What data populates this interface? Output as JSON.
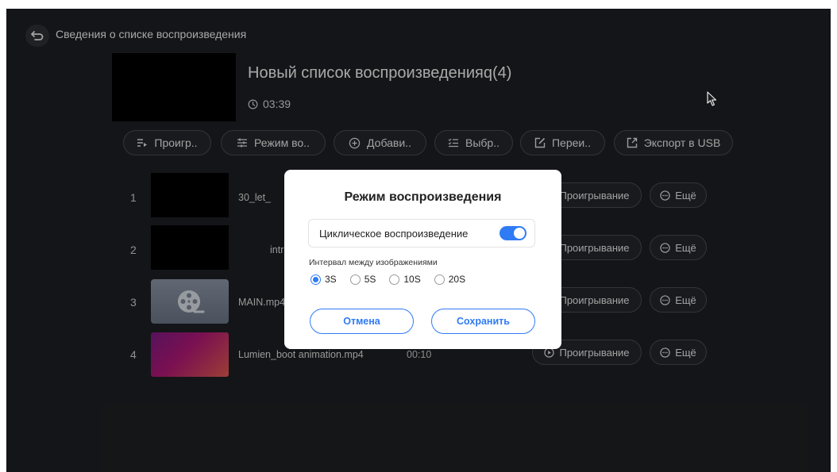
{
  "header": {
    "title": "Сведения о списке воспроизведения"
  },
  "playlist": {
    "title": "Новый список воспроизведенияq(4)",
    "duration": "03:39"
  },
  "toolbar": {
    "play": "Проигр..",
    "mode": "Режим во..",
    "add": "Добави..",
    "select": "Выбр..",
    "rename": "Переи..",
    "export": "Экспорт в USB"
  },
  "items": [
    {
      "index": "1",
      "name": "30_let_",
      "duration": "",
      "play": "Проигрывание",
      "more": "Ещё"
    },
    {
      "index": "2",
      "name": "intr",
      "duration": "",
      "play": "Проигрывание",
      "more": "Ещё"
    },
    {
      "index": "3",
      "name": "MAIN.mp4",
      "duration": "",
      "play": "Проигрывание",
      "more": "Ещё"
    },
    {
      "index": "4",
      "name": "Lumien_boot animation.mp4",
      "duration": "00:10",
      "play": "Проигрывание",
      "more": "Ещё"
    }
  ],
  "dialog": {
    "title": "Режим воспроизведения",
    "loop_label": "Циклическое воспроизведение",
    "loop_enabled": true,
    "interval_label": "Интервал между изображениями",
    "intervals": [
      "3S",
      "5S",
      "10S",
      "20S"
    ],
    "selected_interval": "3S",
    "cancel": "Отмена",
    "save": "Сохранить"
  },
  "colors": {
    "accent": "#2f7bf6",
    "background": "#1e1f23",
    "dialog": "#ffffff"
  },
  "icons": [
    "back-icon",
    "clock-icon",
    "play-list-icon",
    "mode-icon",
    "add-circle-icon",
    "select-list-icon",
    "edit-icon",
    "export-icon",
    "play-circle-icon",
    "more-icon",
    "video-reel-icon",
    "mouse-cursor-icon"
  ]
}
